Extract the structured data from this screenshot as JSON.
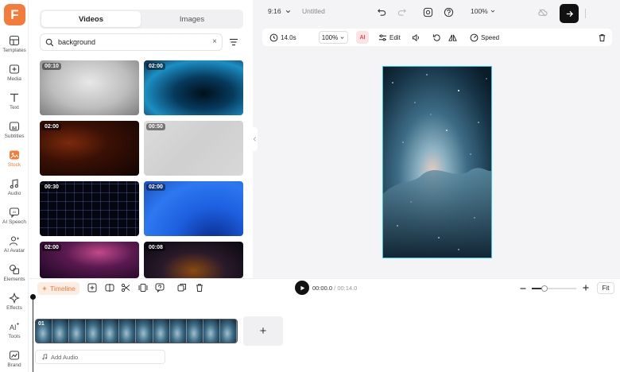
{
  "app": {
    "logo_letter": "F",
    "accent": "#f47b3a"
  },
  "rail": [
    {
      "label": "Templates",
      "icon": "templates-icon"
    },
    {
      "label": "Media",
      "icon": "media-icon"
    },
    {
      "label": "Text",
      "icon": "text-icon"
    },
    {
      "label": "Subtitles",
      "icon": "subtitles-icon"
    },
    {
      "label": "Stock",
      "icon": "stock-icon",
      "active": true
    },
    {
      "label": "Audio",
      "icon": "audio-icon"
    },
    {
      "label": "AI Speech",
      "icon": "ai-speech-icon"
    },
    {
      "label": "AI Avatar",
      "icon": "ai-avatar-icon"
    },
    {
      "label": "Elements",
      "icon": "elements-icon"
    },
    {
      "label": "Effects",
      "icon": "effects-icon"
    },
    {
      "label": "Tools",
      "icon": "tools-icon"
    },
    {
      "label": "Brand",
      "icon": "brand-icon"
    }
  ],
  "panel": {
    "tabs": {
      "videos": "Videos",
      "images": "Images"
    },
    "search_value": "background",
    "clear_symbol": "×",
    "thumbs": [
      {
        "duration": "00:10"
      },
      {
        "duration": "02:00"
      },
      {
        "duration": "02:00"
      },
      {
        "duration": "00:50"
      },
      {
        "duration": "00:30"
      },
      {
        "duration": "02:00"
      },
      {
        "duration": "02:00"
      },
      {
        "duration": "00:08"
      }
    ]
  },
  "topbar": {
    "ratio": "9:16",
    "title": "Untitled",
    "zoom": "100%"
  },
  "toolbar": {
    "duration": "14.0s",
    "zoom": "100%",
    "ai_label": "AI",
    "edit": "Edit",
    "speed": "Speed"
  },
  "timeline": {
    "tab": "Timeline",
    "current_time": "00:00.0",
    "separator": "/",
    "total_time": "00:14.0",
    "fit": "Fit",
    "zoom_level": 0.28,
    "clip_number": "01",
    "add_symbol": "+",
    "add_audio": "Add Audio"
  }
}
